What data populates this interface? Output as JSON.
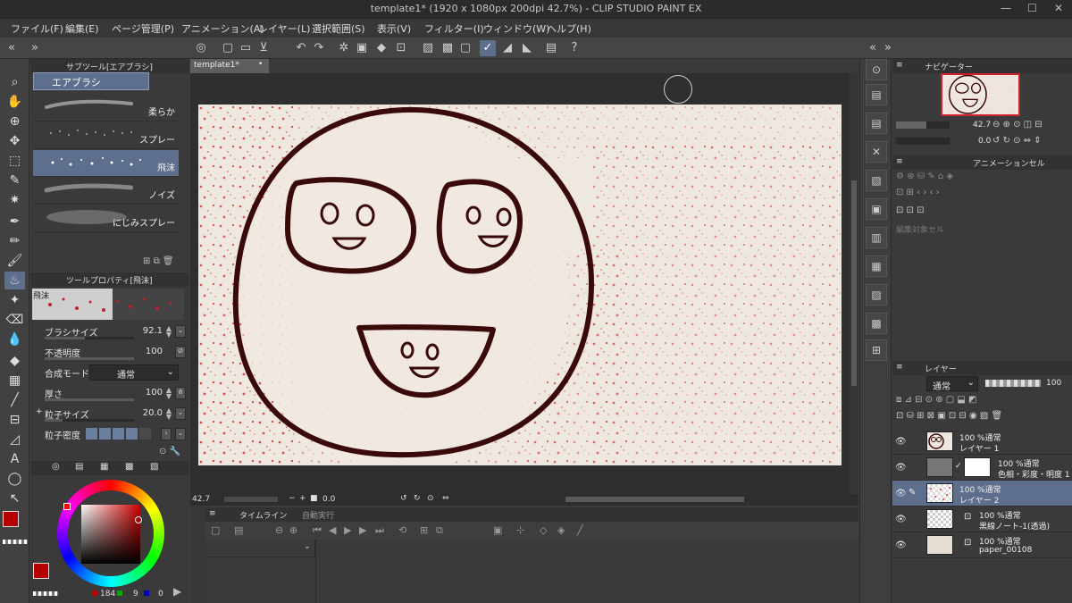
{
  "window": {
    "title": "template1* (1920 x 1080px 200dpi 42.7%)  - CLIP STUDIO PAINT EX",
    "controls": [
      "—",
      "☐",
      "✕"
    ]
  },
  "menu": [
    "ファイル(F)",
    "編集(E)",
    "ページ管理(P)",
    "アニメーション(A)",
    "レイヤー(L)",
    "選択範囲(S)",
    "表示(V)",
    "フィルター(I)",
    "ウィンドウ(W)",
    "ヘルプ(H)"
  ],
  "subtool_panel": {
    "tab": "サブツール[エアブラシ]",
    "group": "エアブラシ",
    "brushes": [
      {
        "name": "柔らか"
      },
      {
        "name": "スプレー"
      },
      {
        "name": "飛沫",
        "selected": true
      },
      {
        "name": "ノイズ"
      },
      {
        "name": "にじみスプレー"
      }
    ]
  },
  "tool_property": {
    "tab": "ツールプロパティ[飛沫]",
    "preview_label": "飛沫",
    "props": [
      {
        "label": "ブラシサイズ",
        "value": "92.1",
        "fill": 0.45
      },
      {
        "label": "不透明度",
        "value": "100",
        "fill": 1.0
      },
      {
        "label": "合成モード",
        "value": "通常"
      },
      {
        "label": "厚さ",
        "value": "100",
        "fill": 1.0
      },
      {
        "label": "粒子サイズ",
        "value": "20.0",
        "fill": 0.2
      },
      {
        "label": "粒子密度"
      }
    ]
  },
  "color": {
    "main": "#b80000",
    "r": "184",
    "g": "9",
    "b": "0"
  },
  "document": {
    "tab": "template1*",
    "zoom": "42.7",
    "angle": "0.0"
  },
  "timeline": {
    "tabs": [
      "タイムライン",
      "自動実行"
    ]
  },
  "navigator": {
    "tab": "ナビゲーター",
    "zoom": "42.7",
    "angle": "0.0"
  },
  "animation_cel": {
    "tab": "アニメーションセル",
    "label": "編集対象セル"
  },
  "layers": {
    "tab": "レイヤー",
    "blend": "通常",
    "opacity": "100",
    "items": [
      {
        "mode": "100 %通常",
        "name": "レイヤー 1",
        "thumb": "face"
      },
      {
        "mode": "100 %通常",
        "name": "色相・彩度・明度 1",
        "thumb": "adjust"
      },
      {
        "mode": "100 %通常",
        "name": "レイヤー 2",
        "thumb": "red",
        "selected": true
      },
      {
        "mode": "100 %通常",
        "name": "黒線ノート-1(透過)",
        "thumb": "checker"
      },
      {
        "mode": "100 %通常",
        "name": "paper_00108",
        "thumb": "paper"
      }
    ]
  },
  "icons": {
    "eye": "eye-icon",
    "pen": "pen-icon"
  }
}
